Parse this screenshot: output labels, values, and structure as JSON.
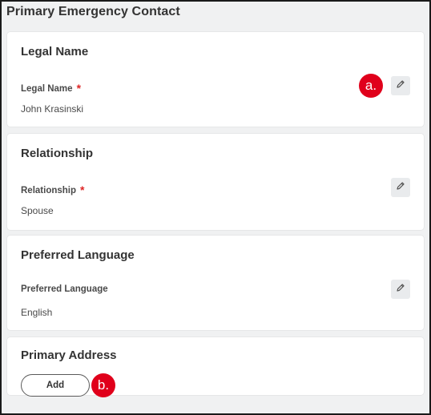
{
  "page_title": "Primary Emergency Contact",
  "sections": {
    "legal_name": {
      "title": "Legal Name",
      "field_label": "Legal Name",
      "required_mark": "*",
      "value": "John Krasinski",
      "edit_icon": "pencil-icon",
      "callout": "a."
    },
    "relationship": {
      "title": "Relationship",
      "field_label": "Relationship",
      "required_mark": "*",
      "value": "Spouse",
      "edit_icon": "pencil-icon"
    },
    "preferred_language": {
      "title": "Preferred Language",
      "field_label": "Preferred Language",
      "value": "English",
      "edit_icon": "pencil-icon"
    },
    "primary_address": {
      "title": "Primary Address",
      "add_label": "Add",
      "callout": "b."
    }
  },
  "colors": {
    "background": "#f0f1f2",
    "card": "#ffffff",
    "required": "#de2626",
    "callout": "#e0001b",
    "edit_button": "#e9ebed"
  }
}
